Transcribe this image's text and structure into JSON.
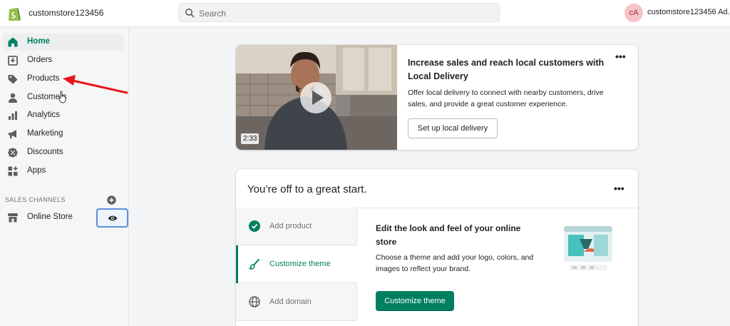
{
  "header": {
    "store_name": "customstore123456",
    "search_placeholder": "Search",
    "avatar_initials": "cA",
    "account_name": "customstore123456 Ad..."
  },
  "sidebar": {
    "items": [
      {
        "label": "Home",
        "icon": "home-icon",
        "active": true
      },
      {
        "label": "Orders",
        "icon": "orders-icon"
      },
      {
        "label": "Products",
        "icon": "tag-icon"
      },
      {
        "label": "Customers",
        "icon": "person-icon"
      },
      {
        "label": "Analytics",
        "icon": "bar-chart-icon"
      },
      {
        "label": "Marketing",
        "icon": "megaphone-icon"
      },
      {
        "label": "Discounts",
        "icon": "discount-icon"
      },
      {
        "label": "Apps",
        "icon": "apps-icon"
      }
    ],
    "sales_channels_label": "SALES CHANNELS",
    "channels": [
      {
        "label": "Online Store",
        "icon": "store-icon"
      }
    ]
  },
  "promo_card": {
    "video_duration": "2:33",
    "title": "Increase sales and reach local customers with Local Delivery",
    "body": "Offer local delivery to connect with nearby customers, drive sales, and provide a great customer experience.",
    "button_label": "Set up local delivery",
    "more_label": "•••"
  },
  "setup_card": {
    "title": "You’re off to a great start.",
    "more_label": "•••",
    "steps": [
      {
        "label": "Add product",
        "icon": "check-circle-icon"
      },
      {
        "label": "Customize theme",
        "icon": "brush-icon",
        "active": true
      },
      {
        "label": "Add domain",
        "icon": "globe-icon"
      }
    ],
    "detail_title": "Edit the look and feel of your online store",
    "detail_body": "Choose a theme and add your logo, colors, and images to reflect your brand.",
    "button_label": "Customize theme"
  },
  "colors": {
    "accent": "#008060",
    "annotation_arrow": "#e8161b"
  }
}
